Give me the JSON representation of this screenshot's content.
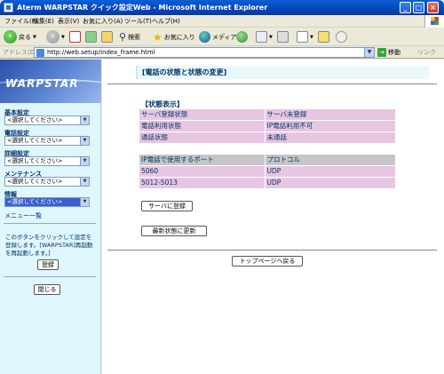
{
  "window": {
    "title": "Aterm WARPSTAR クイック設定Web - Microsoft Internet Explorer",
    "minimize_label": "_",
    "maximize_label": "□",
    "close_label": "×"
  },
  "menu": {
    "items": [
      "ファイル(F)",
      "編集(E)",
      "表示(V)",
      "お気に入り(A)",
      "ツール(T)",
      "ヘルプ(H)"
    ]
  },
  "toolbar": {
    "back_label": "戻る",
    "search_label": "検索",
    "favorites_label": "お気に入り",
    "media_label": "メディア"
  },
  "address": {
    "label": "アドレス(D)",
    "url": "http://web.setup/index_frame.html",
    "go_label": "移動",
    "links_label": "リンク"
  },
  "sidebar": {
    "brand": "WARPSTAR",
    "sections": [
      {
        "label": "基本設定",
        "select_value": "<選択してください>"
      },
      {
        "label": "電話設定",
        "select_value": "<選択してください>"
      },
      {
        "label": "詳細設定",
        "select_value": "<選択してください>"
      },
      {
        "label": "メンテナンス",
        "select_value": "<選択してください>"
      },
      {
        "label": "情報",
        "select_value": "<選択してください>"
      }
    ],
    "menu_list_label": "メニュー一覧",
    "note": "このボタンをクリックして設定を登録します。[WARPSTAR]再起動を再起動します。]",
    "register_button": "登録",
    "close_button": "閉じる"
  },
  "main": {
    "page_title": "[電話の状態と状態の変更]",
    "status_heading": "【状態表示】",
    "status_rows": [
      {
        "label": "サーバ登録状態",
        "value": "サーバ未登録"
      },
      {
        "label": "電話利用状態",
        "value": "IP電話利用不可"
      },
      {
        "label": "通話状態",
        "value": "未通話"
      }
    ],
    "port_header": {
      "label": "IP電話で使用するポート",
      "value": "プロトコル"
    },
    "port_rows": [
      {
        "label": "5060",
        "value": "UDP"
      },
      {
        "label": "5012-5013",
        "value": "UDP"
      }
    ],
    "server_register_button": "サーバに登録",
    "refresh_button": "最新状態に更新",
    "top_page_button": "トップページへ戻る"
  }
}
